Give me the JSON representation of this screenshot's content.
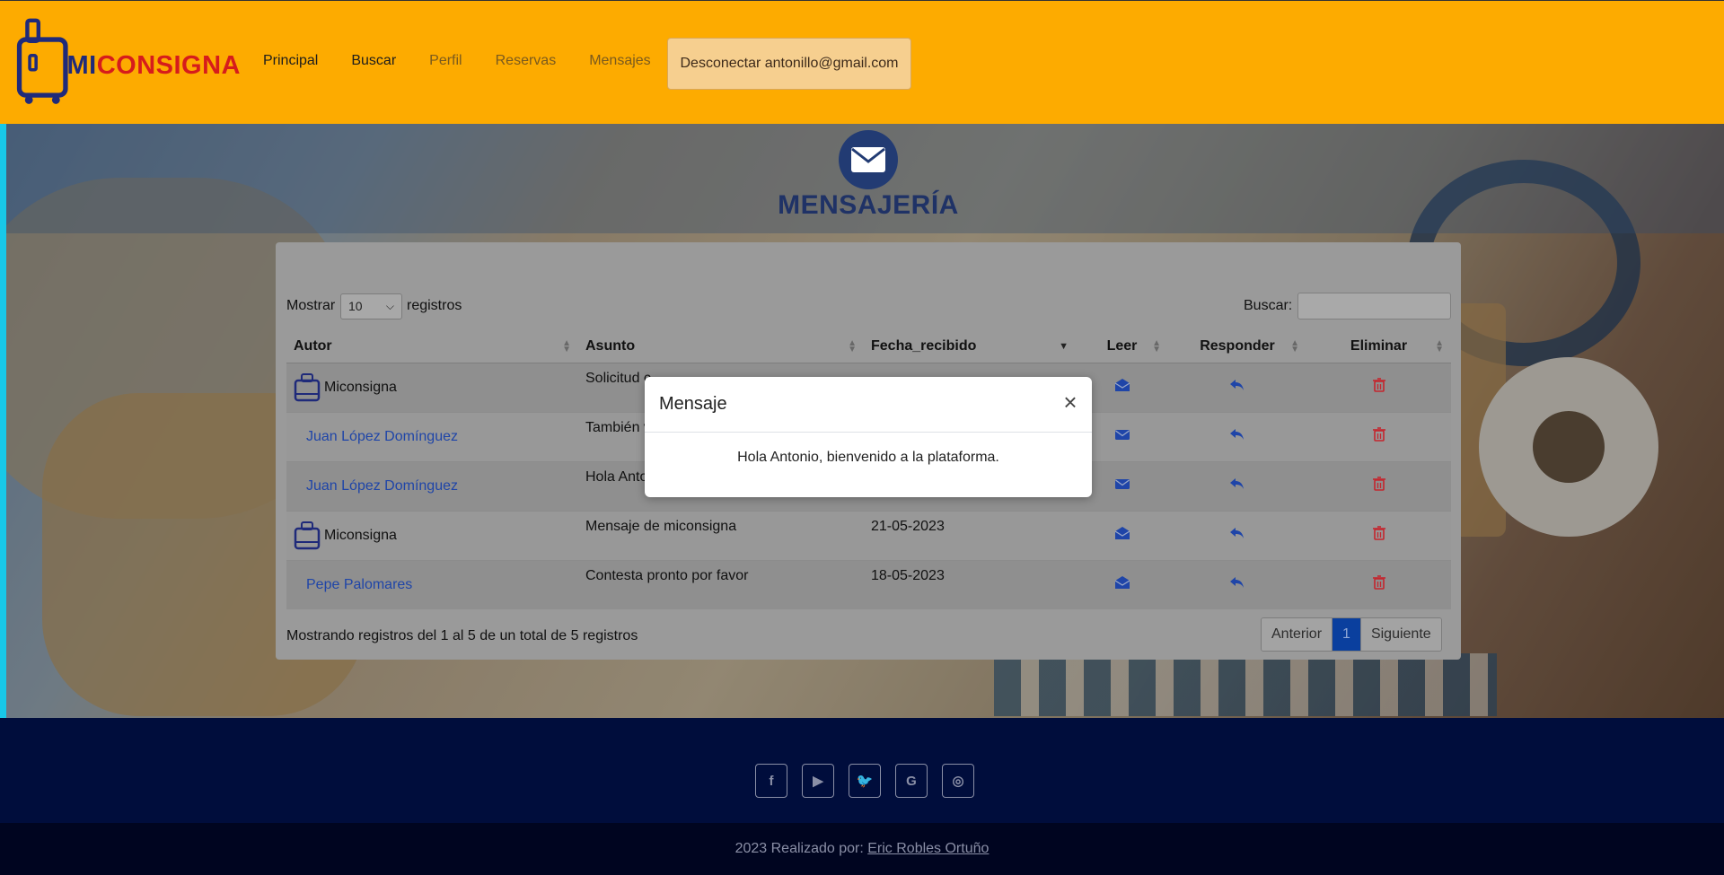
{
  "nav": {
    "logo_mi": "MI",
    "logo_consigna": "CONSIGNA",
    "items": [
      {
        "label": "Principal",
        "state": "active"
      },
      {
        "label": "Buscar",
        "state": "active"
      },
      {
        "label": "Perfil",
        "state": "muted"
      },
      {
        "label": "Reservas",
        "state": "muted"
      },
      {
        "label": "Mensajes",
        "state": "muted"
      }
    ],
    "logout_label": "Desconectar antonillo@gmail.com"
  },
  "page": {
    "title": "MENSAJERÍA",
    "icon": "envelope-icon"
  },
  "table_controls": {
    "show_prefix": "Mostrar",
    "page_size": "10",
    "show_suffix": "registros",
    "search_label": "Buscar:",
    "search_value": ""
  },
  "table": {
    "columns": [
      "Autor",
      "Asunto",
      "Fecha_recibido",
      "Leer",
      "Responder",
      "Eliminar"
    ],
    "rows": [
      {
        "author": "Miconsigna",
        "author_type": "system",
        "subject": "Solicitud c",
        "date": "",
        "read_icon": "envelope-open-icon"
      },
      {
        "author": "Juan López Domínguez",
        "author_type": "user",
        "subject": "También v",
        "date": "",
        "read_icon": "envelope-closed-icon"
      },
      {
        "author": "Juan López Domínguez",
        "author_type": "user",
        "subject": "Hola Anto",
        "date": "",
        "read_icon": "envelope-closed-icon"
      },
      {
        "author": "Miconsigna",
        "author_type": "system",
        "subject": "Mensaje de miconsigna",
        "date": "21-05-2023",
        "read_icon": "envelope-open-icon"
      },
      {
        "author": "Pepe Palomares",
        "author_type": "user",
        "subject": "Contesta pronto por favor",
        "date": "18-05-2023",
        "read_icon": "envelope-open-icon"
      }
    ],
    "info": "Mostrando registros del 1 al 5 de un total de 5 registros",
    "pagination": {
      "prev": "Anterior",
      "current": "1",
      "next": "Siguiente"
    }
  },
  "modal": {
    "title": "Mensaje",
    "close": "×",
    "body": "Hola Antonio, bienvenido a la plataforma."
  },
  "footer": {
    "socials": [
      {
        "icon": "facebook-icon",
        "glyph": "f"
      },
      {
        "icon": "youtube-icon",
        "glyph": "▶"
      },
      {
        "icon": "twitter-icon",
        "glyph": "🐦"
      },
      {
        "icon": "google-icon",
        "glyph": "G"
      },
      {
        "icon": "instagram-icon",
        "glyph": "◎"
      }
    ],
    "copyright_text": "2023 Realizado por: ",
    "author_link": "Eric Robles Ortuño"
  },
  "colors": {
    "navbar": "#fdab00",
    "brand_blue": "#1f2a7a",
    "brand_red": "#d61c1c",
    "footer": "#000d3c",
    "link": "#1f45a8",
    "delete": "#c4262e",
    "pagination_active": "#0a3f9e"
  }
}
